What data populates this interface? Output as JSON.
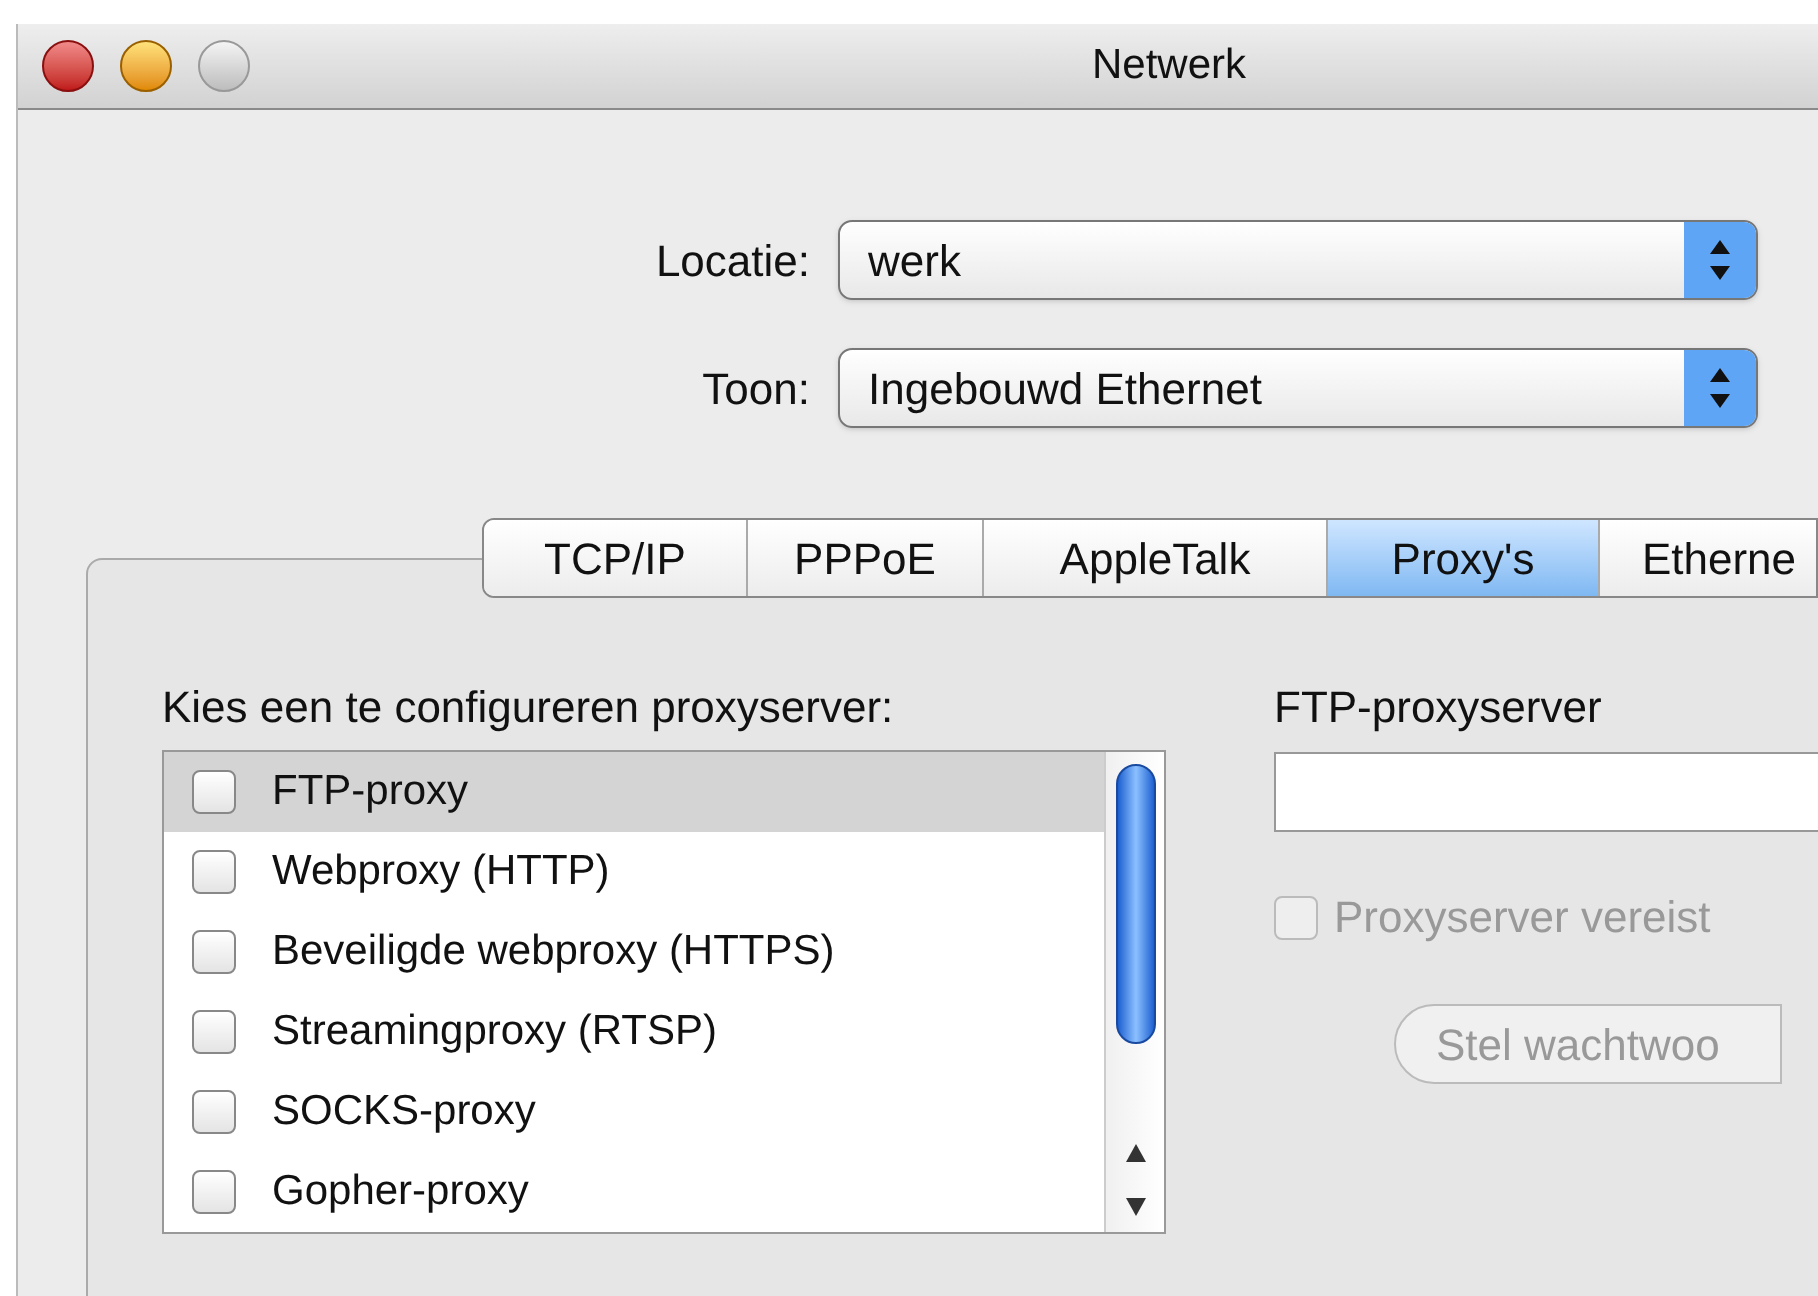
{
  "window": {
    "title": "Netwerk"
  },
  "popups": [
    {
      "label": "Locatie:",
      "value": "werk"
    },
    {
      "label": "Toon:",
      "value": "Ingebouwd Ethernet"
    }
  ],
  "tabs": [
    {
      "label": "TCP/IP",
      "selected": false
    },
    {
      "label": "PPPoE",
      "selected": false
    },
    {
      "label": "AppleTalk",
      "selected": false
    },
    {
      "label": "Proxy's",
      "selected": true
    },
    {
      "label": "Etherne",
      "selected": false
    }
  ],
  "proxy_list": {
    "heading": "Kies een te configureren proxyserver:",
    "items": [
      {
        "label": "FTP-proxy",
        "checked": false,
        "selected": true
      },
      {
        "label": "Webproxy (HTTP)",
        "checked": false,
        "selected": false
      },
      {
        "label": "Beveiligde webproxy (HTTPS)",
        "checked": false,
        "selected": false
      },
      {
        "label": "Streamingproxy (RTSP)",
        "checked": false,
        "selected": false
      },
      {
        "label": "SOCKS-proxy",
        "checked": false,
        "selected": false
      },
      {
        "label": "Gopher-proxy",
        "checked": false,
        "selected": false
      }
    ]
  },
  "server_panel": {
    "heading": "FTP-proxyserver",
    "password_checkbox": {
      "label": "Proxyserver vereist",
      "checked": false,
      "disabled": true
    },
    "password_button": {
      "label": "Stel wachtwoo",
      "disabled": true
    }
  }
}
